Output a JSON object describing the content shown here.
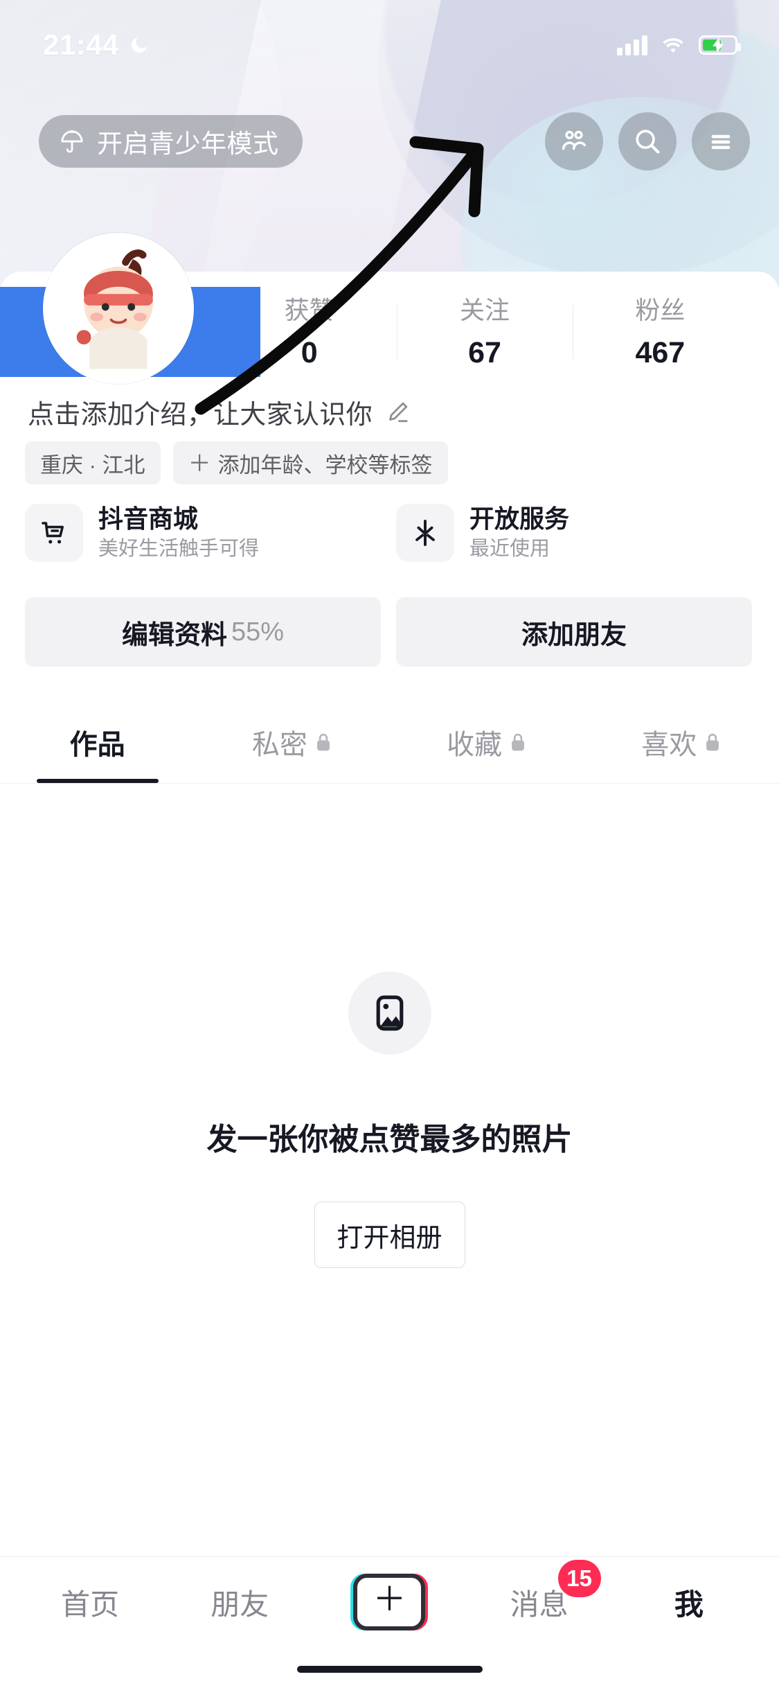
{
  "status_bar": {
    "time": "21:44",
    "moon_icon": "moon-icon",
    "signal_icon": "signal-bars-icon",
    "wifi_icon": "wifi-icon",
    "battery_icon": "battery-charging-icon"
  },
  "top_nav": {
    "teen_mode_label": "开启青少年模式",
    "umbrella_icon": "umbrella-icon",
    "friends_icon": "friends-icon",
    "search_icon": "search-icon",
    "menu_icon": "hamburger-menu-icon"
  },
  "profile": {
    "avatar_icon": "avatar-cartoon",
    "name_redacted": true,
    "redaction_color": "#3c7ceb",
    "stats": [
      {
        "label": "获赞",
        "value": "0"
      },
      {
        "label": "关注",
        "value": "67"
      },
      {
        "label": "粉丝",
        "value": "467"
      }
    ],
    "bio_placeholder": "点击添加介绍，让大家认识你",
    "edit_bio_icon": "pencil-icon",
    "tags": [
      {
        "label": "重庆 · 江北",
        "has_plus": false
      },
      {
        "label": "添加年龄、学校等标签",
        "has_plus": true,
        "plus": "＋"
      }
    ]
  },
  "cards": [
    {
      "icon": "shopping-cart-icon",
      "title": "抖音商城",
      "subtitle": "美好生活触手可得"
    },
    {
      "icon": "open-service-icon",
      "title": "开放服务",
      "subtitle": "最近使用"
    }
  ],
  "actions": [
    {
      "label": "编辑资料",
      "suffix": "55%"
    },
    {
      "label": "添加朋友",
      "suffix": ""
    }
  ],
  "tabs": [
    {
      "label": "作品",
      "locked": false,
      "active": true
    },
    {
      "label": "私密",
      "locked": true,
      "active": false
    },
    {
      "label": "收藏",
      "locked": true,
      "active": false
    },
    {
      "label": "喜欢",
      "locked": true,
      "active": false
    }
  ],
  "empty_state": {
    "icon": "photo-placeholder-icon",
    "title": "发一张你被点赞最多的照片",
    "button_label": "打开相册"
  },
  "bottom_nav": {
    "items": [
      {
        "label": "首页",
        "active": false
      },
      {
        "label": "朋友",
        "active": false
      },
      {
        "label": "",
        "type": "plus-button",
        "glyph": "＋",
        "active": false
      },
      {
        "label": "消息",
        "active": false,
        "badge": "15"
      },
      {
        "label": "我",
        "active": true
      }
    ],
    "badge_color": "#fe2c55"
  },
  "annotation": {
    "type": "arrow",
    "description": "hand-drawn arrow pointing to hamburger menu",
    "color": "#0a0a0a"
  }
}
